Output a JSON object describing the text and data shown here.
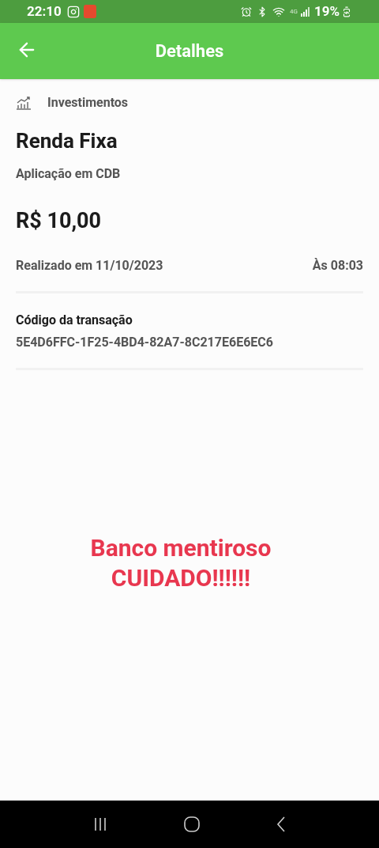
{
  "status_bar": {
    "time": "22:10",
    "network": "4G",
    "battery": "19%"
  },
  "header": {
    "title": "Detalhes"
  },
  "category": "Investimentos",
  "title": "Renda Fixa",
  "subtitle": "Aplicação em CDB",
  "amount": "R$ 10,00",
  "date": "Realizado em 11/10/2023",
  "time": "Às 08:03",
  "transaction": {
    "label": "Código da transação",
    "code": "5E4D6FFC-1F25-4BD4-82A7-8C217E6E6EC6"
  },
  "overlay_text": [
    "Banco mentiroso",
    "CUIDADO!!!!!!"
  ]
}
